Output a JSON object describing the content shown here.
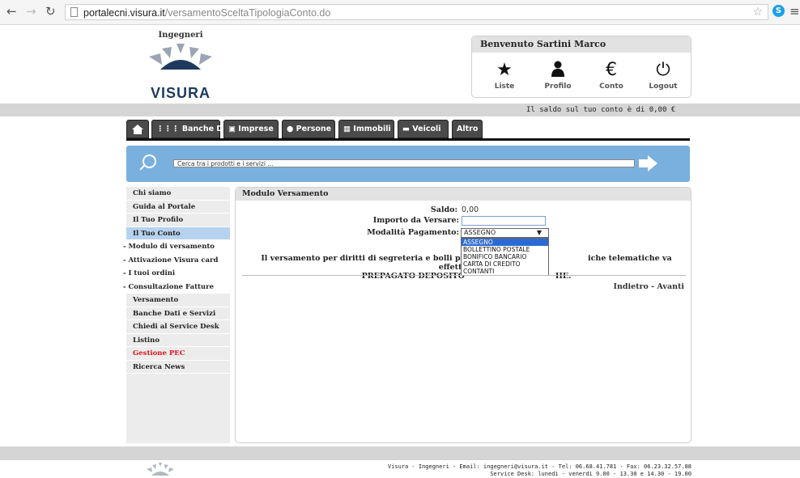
{
  "browser": {
    "url_host": "portalecni.visura.it",
    "url_path": "/versamentoSceltaTipologiaConto.do"
  },
  "header": {
    "logo_top": "Ingegneri",
    "logo_brand": "VISURA",
    "welcome": "Benvenuto Sartini Marco",
    "user_menu": [
      "Liste",
      "Profilo",
      "Conto",
      "Logout"
    ],
    "saldo_text": "Il saldo sul tuo conto è di 0,00 €"
  },
  "tabs": [
    "Banche Dati",
    "Imprese",
    "Persone",
    "Immobili",
    "Veicoli",
    "Altro"
  ],
  "search": {
    "placeholder": "Cerca tra i prodotti e i servizi ..."
  },
  "sidebar": {
    "items": [
      {
        "label": "Chi siamo"
      },
      {
        "label": "Guida al Portale"
      },
      {
        "label": "Il Tuo Profilo"
      },
      {
        "label": "Il Tuo Conto"
      },
      {
        "label": "- Modulo di versamento"
      },
      {
        "label": "- Attivazione Visura card"
      },
      {
        "label": "- I tuoi ordini"
      },
      {
        "label": "- Consultazione Fatture"
      },
      {
        "label": "Versamento"
      },
      {
        "label": "Banche Dati e Servizi"
      },
      {
        "label": "Chiedi al Service Desk"
      },
      {
        "label": "Listino"
      },
      {
        "label": "Gestione PEC"
      },
      {
        "label": "Ricerca News"
      }
    ]
  },
  "panel": {
    "title": "Modulo Versamento",
    "saldo_label": "Saldo:",
    "saldo_value": "0,00",
    "importo_label": "Importo da Versare:",
    "modalita_label": "Modalità Pagamento:",
    "selected": "ASSEGNO",
    "options": [
      "ASSEGNO",
      "BOLLETTINO POSTALE",
      "BONIFICO BANCARIO",
      "CARTA DI CREDITO",
      "CONTANTI"
    ],
    "note_line1_a": "Il versamento per diritti di segreteria e bolli per la pro",
    "note_line1_b": "iche telematiche va effettuato da",
    "note_line2_a": "PREPAGATO DEPOSITO",
    "note_line2_b": "HE.",
    "nav_links": "Indietro - Avanti"
  },
  "footer": {
    "line1": "Visura - Ingegneri - Email: ingegneri@visura.it - Tel: 06.68.41.781 - Fax: 06.23.32.57.88",
    "line2": "Service Desk: lunedì - venerdì 9.00 - 13.30 e 14.30 - 19.00"
  }
}
